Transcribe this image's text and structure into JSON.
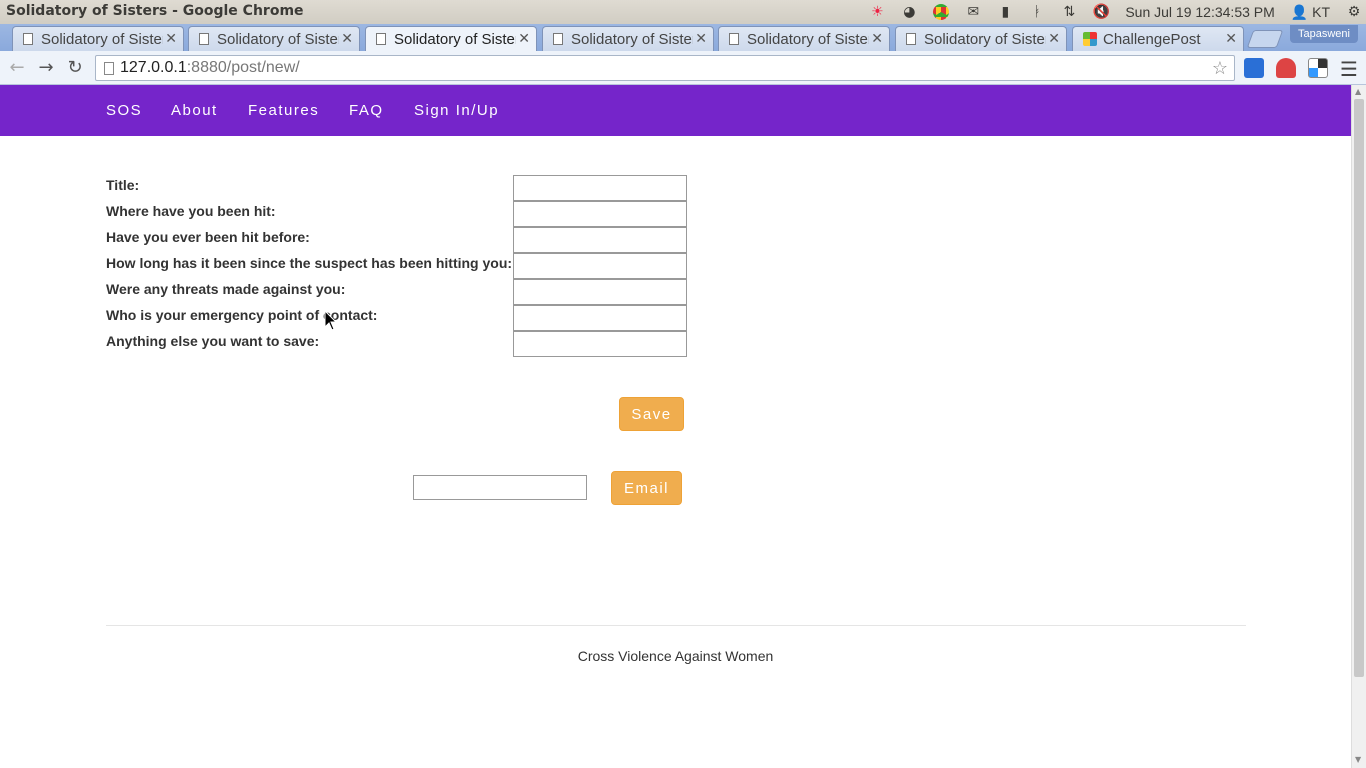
{
  "os": {
    "window_title": "Solidatory of Sisters - Google Chrome",
    "clock": "Sun Jul 19 12:34:53 PM",
    "user": "KT",
    "tray_icons": [
      "weather-icon",
      "ubuntu-one-icon",
      "chrome-icon",
      "mail-icon",
      "battery-icon",
      "bluetooth-icon",
      "network-icon",
      "volume-muted-icon",
      "settings-gear-icon"
    ]
  },
  "browser": {
    "tabs": [
      {
        "label": "Solidatory of Sisters",
        "active": false
      },
      {
        "label": "Solidatory of Sisters",
        "active": false
      },
      {
        "label": "Solidatory of Sisters",
        "active": true
      },
      {
        "label": "Solidatory of Sisters",
        "active": false
      },
      {
        "label": "Solidatory of Sisters",
        "active": false
      },
      {
        "label": "Solidatory of Sisters",
        "active": false
      },
      {
        "label": "ChallengePost",
        "active": false
      }
    ],
    "profile_name": "Tapasweni",
    "url_host": "127.0.0.1",
    "url_rest": ":8880/post/new/"
  },
  "site": {
    "nav": {
      "brand": "SOS",
      "about": "About",
      "features": "Features",
      "faq": "FAQ",
      "signin": "Sign In/Up"
    },
    "form": {
      "fields": [
        {
          "label": "Title:",
          "value": ""
        },
        {
          "label": "Where have you been hit:",
          "value": ""
        },
        {
          "label": "Have you ever been hit before:",
          "value": ""
        },
        {
          "label": "How long has it been since the suspect has been hitting you:",
          "value": ""
        },
        {
          "label": "Were any threats made against you:",
          "value": ""
        },
        {
          "label": "Who is your emergency point of contact:",
          "value": ""
        },
        {
          "label": "Anything else you want to save:",
          "value": ""
        }
      ],
      "save_label": "Save",
      "email_value": "",
      "email_label": "Email"
    },
    "footer": {
      "text": "Cross Violence Against Women"
    }
  }
}
